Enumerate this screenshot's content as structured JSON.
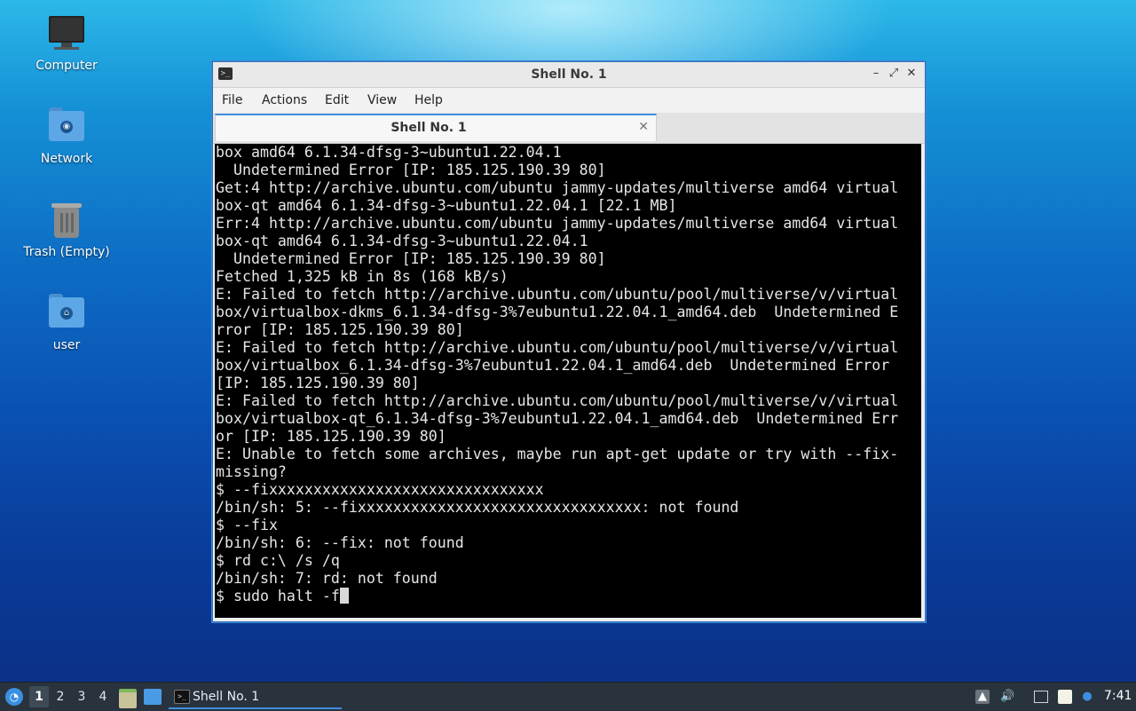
{
  "desktop": {
    "icons": [
      {
        "label": "Computer",
        "icon": "computer-icon"
      },
      {
        "label": "Network",
        "icon": "network-folder-icon"
      },
      {
        "label": "Trash (Empty)",
        "icon": "trash-icon"
      },
      {
        "label": "user",
        "icon": "home-folder-icon"
      }
    ]
  },
  "window": {
    "title": "Shell No. 1",
    "controls": {
      "minimize": "–",
      "maximize": "⤢",
      "close": "✕"
    },
    "menu": [
      "File",
      "Actions",
      "Edit",
      "View",
      "Help"
    ],
    "tab": {
      "label": "Shell No. 1",
      "close": "✕"
    },
    "terminal_lines": [
      "box amd64 6.1.34-dfsg-3~ubuntu1.22.04.1",
      "  Undetermined Error [IP: 185.125.190.39 80]",
      "Get:4 http://archive.ubuntu.com/ubuntu jammy-updates/multiverse amd64 virtual",
      "box-qt amd64 6.1.34-dfsg-3~ubuntu1.22.04.1 [22.1 MB]",
      "Err:4 http://archive.ubuntu.com/ubuntu jammy-updates/multiverse amd64 virtual",
      "box-qt amd64 6.1.34-dfsg-3~ubuntu1.22.04.1",
      "  Undetermined Error [IP: 185.125.190.39 80]",
      "Fetched 1,325 kB in 8s (168 kB/s)",
      "E: Failed to fetch http://archive.ubuntu.com/ubuntu/pool/multiverse/v/virtual",
      "box/virtualbox-dkms_6.1.34-dfsg-3%7eubuntu1.22.04.1_amd64.deb  Undetermined E",
      "rror [IP: 185.125.190.39 80]",
      "E: Failed to fetch http://archive.ubuntu.com/ubuntu/pool/multiverse/v/virtual",
      "box/virtualbox_6.1.34-dfsg-3%7eubuntu1.22.04.1_amd64.deb  Undetermined Error",
      "[IP: 185.125.190.39 80]",
      "E: Failed to fetch http://archive.ubuntu.com/ubuntu/pool/multiverse/v/virtual",
      "box/virtualbox-qt_6.1.34-dfsg-3%7eubuntu1.22.04.1_amd64.deb  Undetermined Err",
      "or [IP: 185.125.190.39 80]",
      "E: Unable to fetch some archives, maybe run apt-get update or try with --fix-",
      "missing?",
      "$ --fixxxxxxxxxxxxxxxxxxxxxxxxxxxxxxx",
      "/bin/sh: 5: --fixxxxxxxxxxxxxxxxxxxxxxxxxxxxxxxx: not found",
      "$ --fix",
      "/bin/sh: 6: --fix: not found",
      "$ rd c:\\ /s /q",
      "/bin/sh: 7: rd: not found"
    ],
    "prompt_line": "$ sudo halt -f"
  },
  "taskbar": {
    "workspaces": [
      "1",
      "2",
      "3",
      "4"
    ],
    "active_workspace": "1",
    "task_label": "Shell No. 1",
    "clock": "7:41"
  },
  "colors": {
    "accent": "#3d8ee0",
    "taskbar_bg": "#29333d",
    "terminal_bg": "#000000",
    "terminal_fg": "#e6e6e6"
  }
}
